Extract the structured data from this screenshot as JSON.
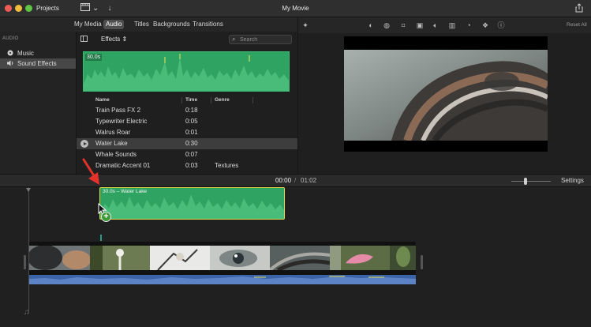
{
  "window": {
    "title": "My Movie",
    "projects_label": "Projects",
    "share_icon": "share-icon"
  },
  "browser_tabs": [
    "My Media",
    "Audio",
    "Titles",
    "Backgrounds",
    "Transitions"
  ],
  "active_tab": "Audio",
  "sidebar": {
    "header": "AUDIO",
    "items": [
      {
        "label": "Music",
        "icon": "music-disc-icon"
      },
      {
        "label": "Sound Effects",
        "icon": "speaker-icon"
      }
    ],
    "selected": "Sound Effects"
  },
  "effects": {
    "dropdown_label": "Effects",
    "search_placeholder": "Search",
    "preview_duration": "30.0s"
  },
  "sound_list": {
    "columns": [
      "Name",
      "Time",
      "Genre"
    ],
    "rows": [
      {
        "name": "Train Pass FX 2",
        "time": "0:18",
        "genre": ""
      },
      {
        "name": "Typewriter Electric",
        "time": "0:05",
        "genre": ""
      },
      {
        "name": "Walrus Roar",
        "time": "0:01",
        "genre": ""
      },
      {
        "name": "Water Lake",
        "time": "0:30",
        "genre": ""
      },
      {
        "name": "Whale Sounds",
        "time": "0:07",
        "genre": ""
      },
      {
        "name": "Dramatic Accent 01",
        "time": "0:03",
        "genre": "Textures"
      }
    ],
    "selected_row": 3
  },
  "viewer": {
    "reset_all": "Reset All",
    "tools": [
      "magic-wand-icon",
      "color-balance-icon",
      "color-correction-icon",
      "crop-icon",
      "stabilization-icon",
      "volume-icon",
      "equalizer-icon",
      "speed-icon",
      "filter-icon",
      "info-icon"
    ]
  },
  "timeline": {
    "current_time": "00:00",
    "separator": "/",
    "total_time": "01:02",
    "settings_label": "Settings",
    "audio_clip_label": "30.0s – Water Lake",
    "zoom_level": 0.34
  },
  "colors": {
    "waveform_green": "#2fa462",
    "clip_border_yellow": "#e1d94a",
    "audio_track_blue": "#3a63a8",
    "annotation_red": "#e4322b"
  }
}
